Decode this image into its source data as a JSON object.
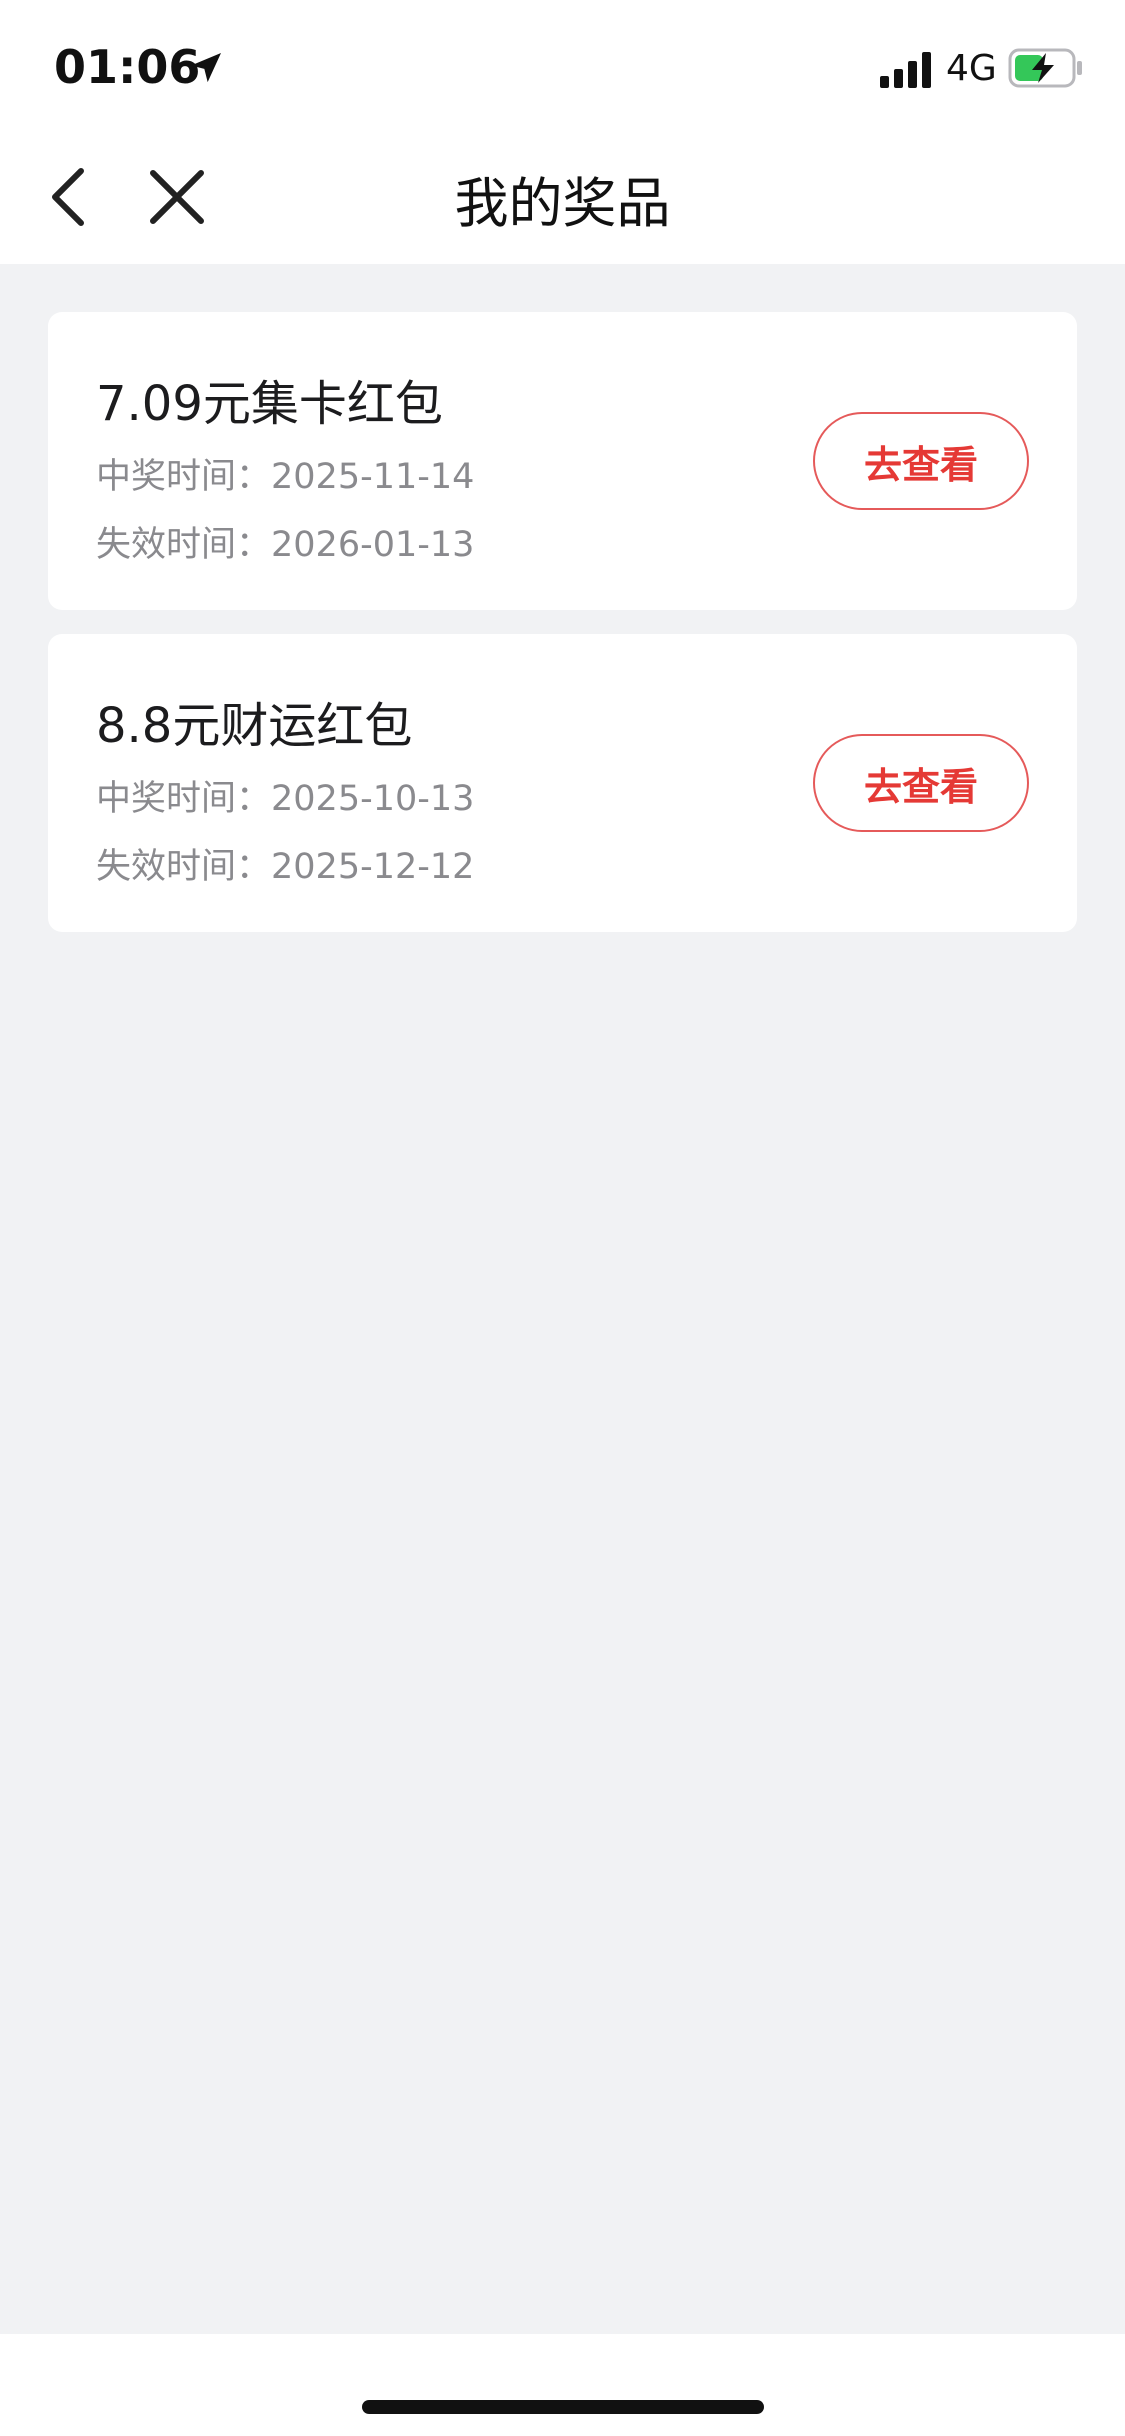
{
  "status_bar": {
    "time": "01:06",
    "network": "4G",
    "icons": [
      "location-arrow-icon",
      "signal-icon",
      "battery-charging-icon"
    ],
    "battery_color": "#34c759"
  },
  "nav": {
    "title": "我的奖品",
    "icons": [
      "chevron-left-icon",
      "close-icon"
    ]
  },
  "prizes": [
    {
      "name": "7.09元集卡红包",
      "win_label": "中奖时间：",
      "win_date": "2025-11-14",
      "expire_label": "失效时间：",
      "expire_date": "2026-01-13",
      "action_label": "去查看"
    },
    {
      "name": "8.8元财运红包",
      "win_label": "中奖时间：",
      "win_date": "2025-10-13",
      "expire_label": "失效时间：",
      "expire_date": "2025-12-12",
      "action_label": "去查看"
    }
  ],
  "colors": {
    "accent": "#e53935",
    "background": "#f1f2f4",
    "card": "#ffffff",
    "secondary_text": "#8a8a8e"
  }
}
